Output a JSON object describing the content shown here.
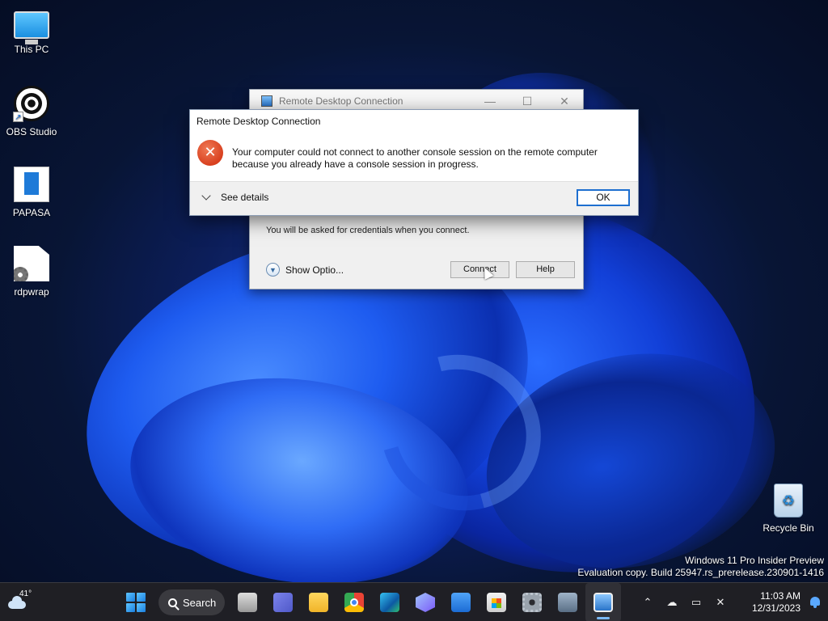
{
  "desktop": {
    "icons": [
      {
        "label": "This PC"
      },
      {
        "label": "OBS Studio"
      },
      {
        "label": "PAPASA"
      },
      {
        "label": "rdpwrap"
      },
      {
        "label": "Recycle Bin"
      }
    ]
  },
  "rdc_window": {
    "title": "Remote Desktop Connection",
    "credentials_note": "You will be asked for credentials when you connect.",
    "show_options_label": "Show Optio...",
    "connect_label": "Connect",
    "help_label": "Help",
    "minimize_glyph": "—",
    "maximize_glyph": "☐",
    "close_glyph": "✕"
  },
  "error_dialog": {
    "title": "Remote Desktop Connection",
    "message_line1": "Your computer could not connect to another console session on the remote computer",
    "message_line2": "because you already have a console session in progress.",
    "see_details_label": "See details",
    "ok_label": "OK",
    "icon": "error-x-icon",
    "icon_glyph": "✕"
  },
  "watermark": {
    "line1": "Windows 11 Pro Insider Preview",
    "line2": "Evaluation copy. Build 25947.rs_prerelease.230901-1416"
  },
  "taskbar": {
    "weather_temp": "41°",
    "search_label": "Search",
    "apps": [
      "start",
      "search",
      "task-view",
      "teams-chat",
      "file-explorer",
      "chrome",
      "edge",
      "copilot",
      "mail",
      "store",
      "settings",
      "rdp-manager",
      "remote-desktop-connection"
    ],
    "clock_time": "11:03 AM",
    "clock_date": "12/31/2023"
  },
  "colors": {
    "accent": "#1e6fd0",
    "error": "#d8401f",
    "taskbar": "#202024"
  }
}
